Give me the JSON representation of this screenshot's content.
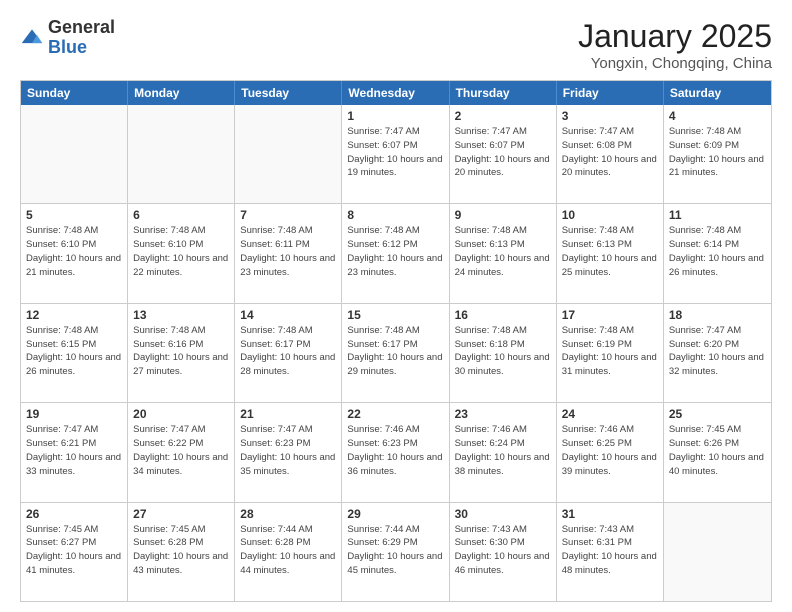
{
  "header": {
    "logo_general": "General",
    "logo_blue": "Blue",
    "month_title": "January 2025",
    "location": "Yongxin, Chongqing, China"
  },
  "days_of_week": [
    "Sunday",
    "Monday",
    "Tuesday",
    "Wednesday",
    "Thursday",
    "Friday",
    "Saturday"
  ],
  "weeks": [
    [
      {
        "num": "",
        "info": ""
      },
      {
        "num": "",
        "info": ""
      },
      {
        "num": "",
        "info": ""
      },
      {
        "num": "1",
        "info": "Sunrise: 7:47 AM\nSunset: 6:07 PM\nDaylight: 10 hours and 19 minutes."
      },
      {
        "num": "2",
        "info": "Sunrise: 7:47 AM\nSunset: 6:07 PM\nDaylight: 10 hours and 20 minutes."
      },
      {
        "num": "3",
        "info": "Sunrise: 7:47 AM\nSunset: 6:08 PM\nDaylight: 10 hours and 20 minutes."
      },
      {
        "num": "4",
        "info": "Sunrise: 7:48 AM\nSunset: 6:09 PM\nDaylight: 10 hours and 21 minutes."
      }
    ],
    [
      {
        "num": "5",
        "info": "Sunrise: 7:48 AM\nSunset: 6:10 PM\nDaylight: 10 hours and 21 minutes."
      },
      {
        "num": "6",
        "info": "Sunrise: 7:48 AM\nSunset: 6:10 PM\nDaylight: 10 hours and 22 minutes."
      },
      {
        "num": "7",
        "info": "Sunrise: 7:48 AM\nSunset: 6:11 PM\nDaylight: 10 hours and 23 minutes."
      },
      {
        "num": "8",
        "info": "Sunrise: 7:48 AM\nSunset: 6:12 PM\nDaylight: 10 hours and 23 minutes."
      },
      {
        "num": "9",
        "info": "Sunrise: 7:48 AM\nSunset: 6:13 PM\nDaylight: 10 hours and 24 minutes."
      },
      {
        "num": "10",
        "info": "Sunrise: 7:48 AM\nSunset: 6:13 PM\nDaylight: 10 hours and 25 minutes."
      },
      {
        "num": "11",
        "info": "Sunrise: 7:48 AM\nSunset: 6:14 PM\nDaylight: 10 hours and 26 minutes."
      }
    ],
    [
      {
        "num": "12",
        "info": "Sunrise: 7:48 AM\nSunset: 6:15 PM\nDaylight: 10 hours and 26 minutes."
      },
      {
        "num": "13",
        "info": "Sunrise: 7:48 AM\nSunset: 6:16 PM\nDaylight: 10 hours and 27 minutes."
      },
      {
        "num": "14",
        "info": "Sunrise: 7:48 AM\nSunset: 6:17 PM\nDaylight: 10 hours and 28 minutes."
      },
      {
        "num": "15",
        "info": "Sunrise: 7:48 AM\nSunset: 6:17 PM\nDaylight: 10 hours and 29 minutes."
      },
      {
        "num": "16",
        "info": "Sunrise: 7:48 AM\nSunset: 6:18 PM\nDaylight: 10 hours and 30 minutes."
      },
      {
        "num": "17",
        "info": "Sunrise: 7:48 AM\nSunset: 6:19 PM\nDaylight: 10 hours and 31 minutes."
      },
      {
        "num": "18",
        "info": "Sunrise: 7:47 AM\nSunset: 6:20 PM\nDaylight: 10 hours and 32 minutes."
      }
    ],
    [
      {
        "num": "19",
        "info": "Sunrise: 7:47 AM\nSunset: 6:21 PM\nDaylight: 10 hours and 33 minutes."
      },
      {
        "num": "20",
        "info": "Sunrise: 7:47 AM\nSunset: 6:22 PM\nDaylight: 10 hours and 34 minutes."
      },
      {
        "num": "21",
        "info": "Sunrise: 7:47 AM\nSunset: 6:23 PM\nDaylight: 10 hours and 35 minutes."
      },
      {
        "num": "22",
        "info": "Sunrise: 7:46 AM\nSunset: 6:23 PM\nDaylight: 10 hours and 36 minutes."
      },
      {
        "num": "23",
        "info": "Sunrise: 7:46 AM\nSunset: 6:24 PM\nDaylight: 10 hours and 38 minutes."
      },
      {
        "num": "24",
        "info": "Sunrise: 7:46 AM\nSunset: 6:25 PM\nDaylight: 10 hours and 39 minutes."
      },
      {
        "num": "25",
        "info": "Sunrise: 7:45 AM\nSunset: 6:26 PM\nDaylight: 10 hours and 40 minutes."
      }
    ],
    [
      {
        "num": "26",
        "info": "Sunrise: 7:45 AM\nSunset: 6:27 PM\nDaylight: 10 hours and 41 minutes."
      },
      {
        "num": "27",
        "info": "Sunrise: 7:45 AM\nSunset: 6:28 PM\nDaylight: 10 hours and 43 minutes."
      },
      {
        "num": "28",
        "info": "Sunrise: 7:44 AM\nSunset: 6:28 PM\nDaylight: 10 hours and 44 minutes."
      },
      {
        "num": "29",
        "info": "Sunrise: 7:44 AM\nSunset: 6:29 PM\nDaylight: 10 hours and 45 minutes."
      },
      {
        "num": "30",
        "info": "Sunrise: 7:43 AM\nSunset: 6:30 PM\nDaylight: 10 hours and 46 minutes."
      },
      {
        "num": "31",
        "info": "Sunrise: 7:43 AM\nSunset: 6:31 PM\nDaylight: 10 hours and 48 minutes."
      },
      {
        "num": "",
        "info": ""
      }
    ]
  ]
}
